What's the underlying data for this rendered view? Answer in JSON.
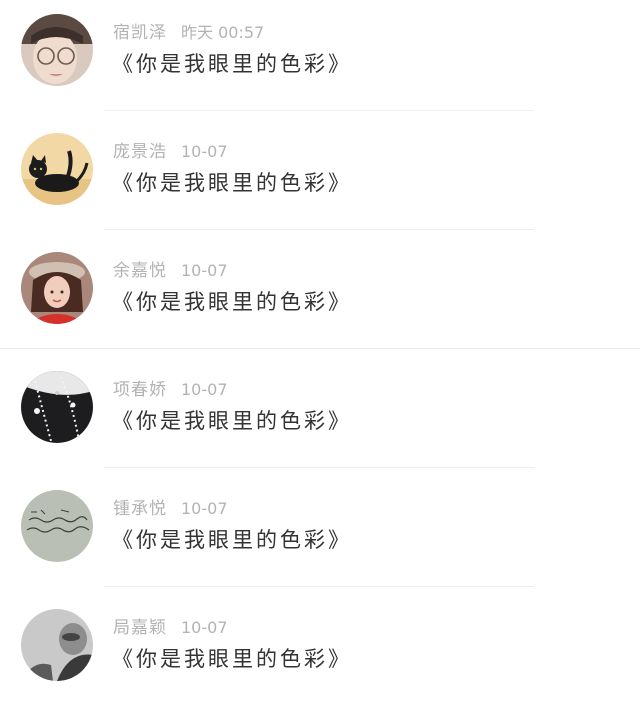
{
  "comments": [
    {
      "name": "宿凯泽",
      "time": "昨天 00:57",
      "message": "《你是我眼里的色彩》",
      "avatar": "avatar-photo-person-glasses"
    },
    {
      "name": "庞景浩",
      "time": "10-07",
      "message": "《你是我眼里的色彩》",
      "avatar": "avatar-photo-black-cat"
    },
    {
      "name": "余嘉悦",
      "time": "10-07",
      "message": "《你是我眼里的色彩》",
      "avatar": "avatar-photo-girl-hat"
    },
    {
      "name": "项春娇",
      "time": "10-07",
      "message": "《你是我眼里的色彩》",
      "avatar": "avatar-photo-pearl-necklace"
    },
    {
      "name": "锺承悦",
      "time": "10-07",
      "message": "《你是我眼里的色彩》",
      "avatar": "avatar-photo-handwriting"
    },
    {
      "name": "局嘉颖",
      "time": "10-07",
      "message": "《你是我眼里的色彩》",
      "avatar": "avatar-photo-grayscale-person"
    }
  ],
  "colors": {
    "background": "#ffffff",
    "name_text": "#b3b3b3",
    "message_text": "#333333",
    "divider": "#eeeeee"
  }
}
